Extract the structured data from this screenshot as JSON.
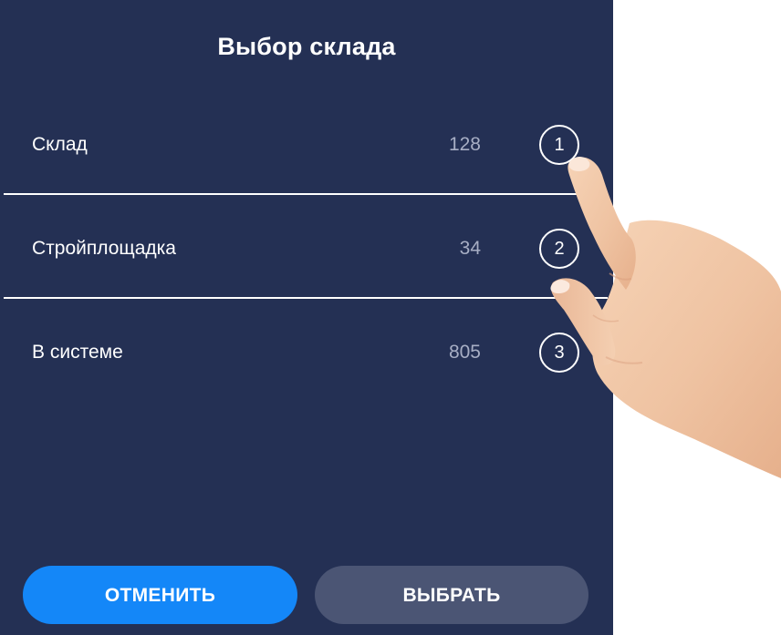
{
  "dialog": {
    "title": "Выбор склада",
    "items": [
      {
        "label": "Склад",
        "count": "128",
        "badge": "1"
      },
      {
        "label": "Стройплощадка",
        "count": "34",
        "badge": "2"
      },
      {
        "label": "В системе",
        "count": "805",
        "badge": "3"
      }
    ],
    "cancel_label": "ОТМЕНИТЬ",
    "select_label": "ВЫБРАТЬ"
  },
  "colors": {
    "panel_background": "#243054",
    "cancel_button": "#1487f8",
    "select_button": "#4b5574",
    "count_text": "#a7aec4",
    "page_background": "#ffffff"
  },
  "overlay": {
    "icon": "pointing-hand-icon"
  }
}
